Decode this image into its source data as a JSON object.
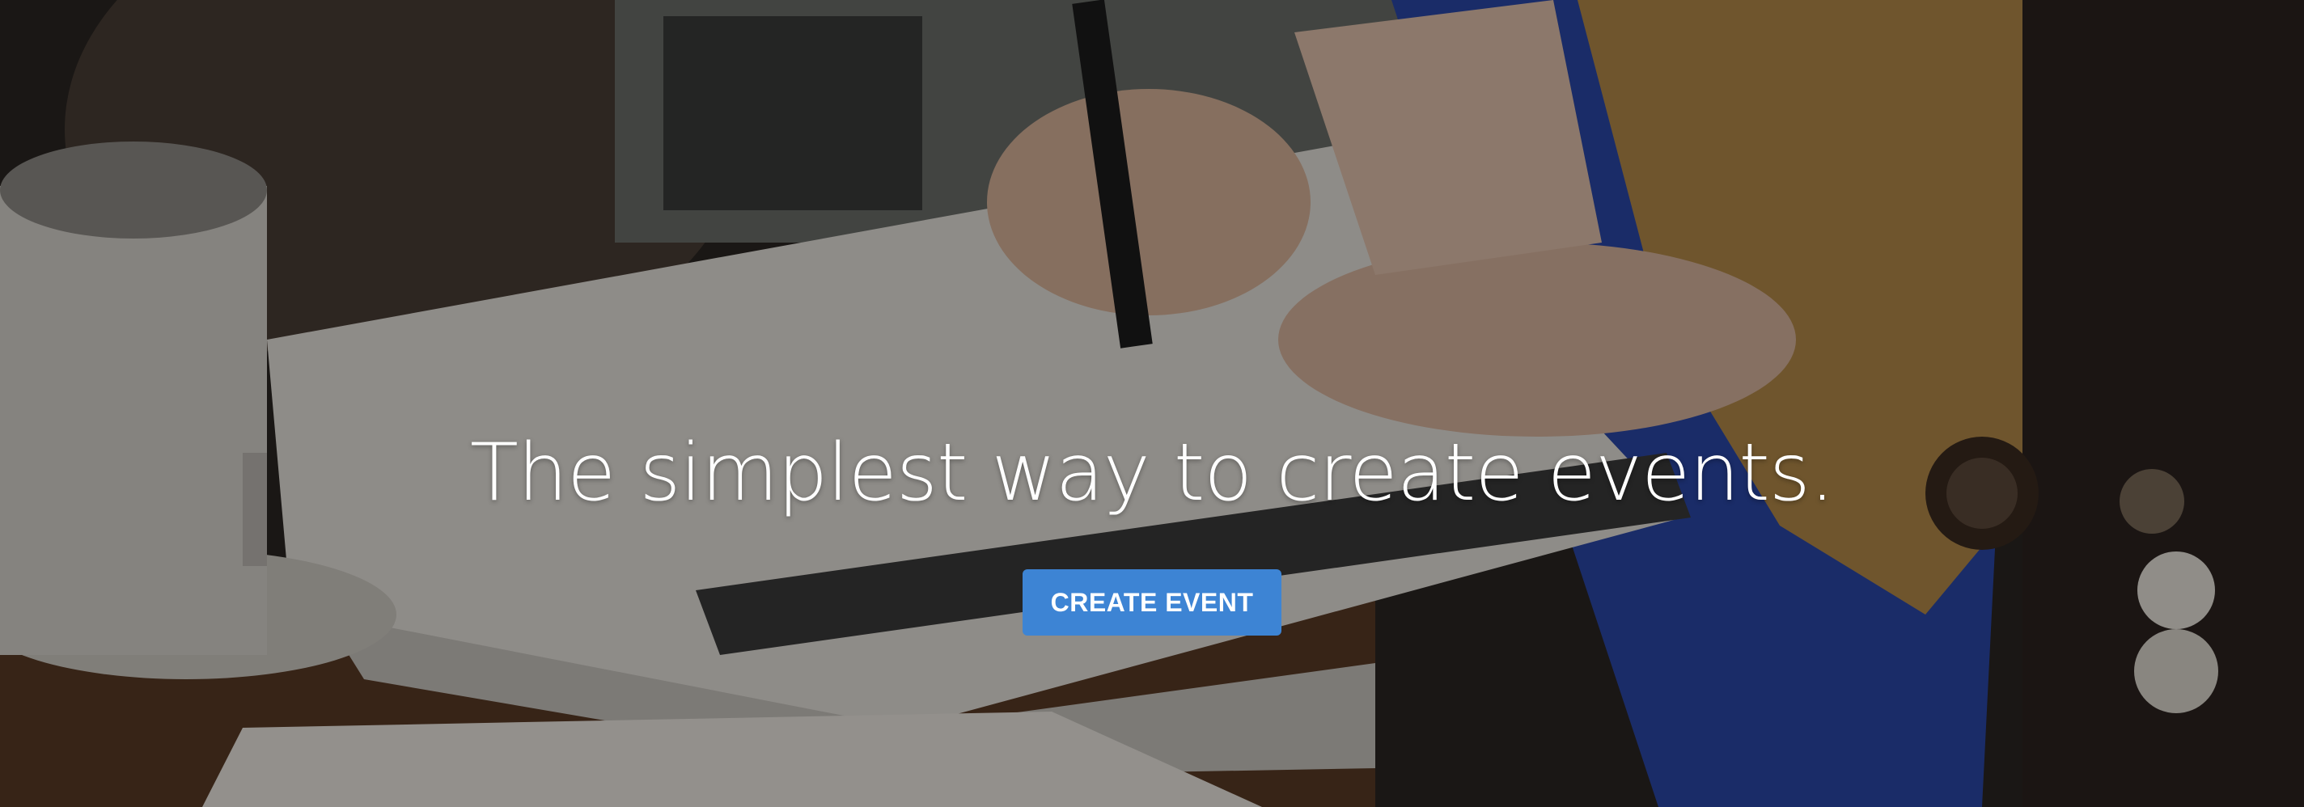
{
  "hero": {
    "headline": "The simplest way to create events.",
    "cta_label": "CREATE EVENT",
    "accent_color": "#3d84d4",
    "background_description_icon": "photo-background"
  }
}
